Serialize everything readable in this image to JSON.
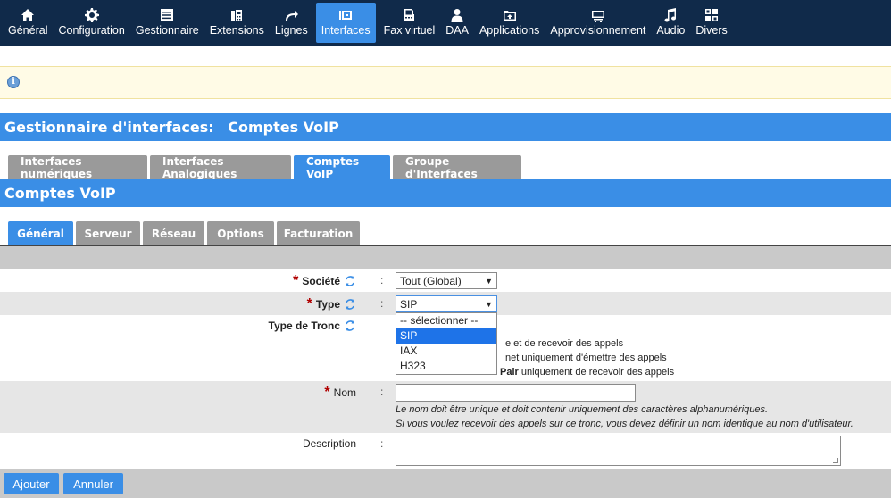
{
  "nav": {
    "items": [
      {
        "label": "Général",
        "icon": "home-icon"
      },
      {
        "label": "Configuration",
        "icon": "gear-icon"
      },
      {
        "label": "Gestionnaire",
        "icon": "list-icon"
      },
      {
        "label": "Extensions",
        "icon": "phone-icon"
      },
      {
        "label": "Lignes",
        "icon": "route-icon"
      },
      {
        "label": "Interfaces",
        "icon": "interface-icon",
        "active": true
      },
      {
        "label": "Fax virtuel",
        "icon": "fax-icon"
      },
      {
        "label": "DAA",
        "icon": "user-icon"
      },
      {
        "label": "Applications",
        "icon": "applications-icon"
      },
      {
        "label": "Approvisionnement",
        "icon": "provisioning-icon"
      },
      {
        "label": "Audio",
        "icon": "music-icon"
      },
      {
        "label": "Divers",
        "icon": "misc-icon"
      }
    ]
  },
  "info": {
    "icon": "info-icon"
  },
  "page": {
    "title_left": "Gestionnaire d'interfaces:",
    "title_right": "Comptes VoIP",
    "section_title": "Comptes VoIP"
  },
  "tabs_main": [
    "Interfaces numériques",
    "Interfaces Analogiques",
    "Comptes VoIP",
    "Groupe d'Interfaces"
  ],
  "tabs_main_active": 2,
  "tabs_sub": [
    "Général",
    "Serveur",
    "Réseau",
    "Options",
    "Facturation"
  ],
  "tabs_sub_active": 0,
  "form": {
    "societe_label": "Société",
    "societe_value": "Tout (Global)",
    "type_label": "Type",
    "type_value": "SIP",
    "type_options": [
      "-- sélectionner --",
      "SIP",
      "IAX",
      "H323"
    ],
    "type_selected_index": 1,
    "tronc_label": "Type de Tronc",
    "tronc_help_1": "e et de recevoir des appels",
    "tronc_help_2": "net uniquement d'émettre des appels",
    "tronc_help_3_bold": "Pair",
    "tronc_help_3": "uniquement de recevoir des appels",
    "nom_label": "Nom",
    "nom_value": "",
    "nom_help_1": "Le nom doit être unique et doit contenir uniquement des caractères alphanumériques.",
    "nom_help_2": "Si vous voulez recevoir des appels sur ce tronc, vous devez définir un nom identique au nom d'utilisateur.",
    "description_label": "Description",
    "colon": ":"
  },
  "buttons": {
    "add": "Ajouter",
    "cancel": "Annuler"
  },
  "colors": {
    "nav_bg": "#102a4a",
    "accent": "#3a8ee6",
    "tab_inactive": "#9a9a9a",
    "required": "#b00000"
  }
}
